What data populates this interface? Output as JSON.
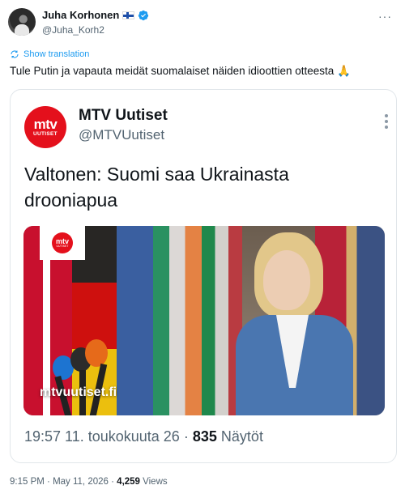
{
  "tweet": {
    "author_name": "Juha Korhonen",
    "author_handle": "@Juha_Korh2",
    "show_translation": "Show translation",
    "text": "Tule Putin ja vapauta meidät suomalaiset näiden idioottien otteesta 🙏",
    "time": "9:15 PM",
    "date": "May 11, 2026",
    "views_count": "4,259",
    "views_label": "Views",
    "separator": "·"
  },
  "quoted": {
    "logo_top": "mtv",
    "logo_bottom": "UUTISET",
    "name": "MTV Uutiset",
    "handle": "@MTVUutiset",
    "headline": "Valtonen: Suomi saa Ukrainasta drooniapua",
    "image_watermark": "mtvuutiset.fi",
    "time_date": "19:57 11. toukokuuta 26",
    "views_count": "835",
    "views_label": "Näytöt"
  },
  "icons": {
    "more": "more-horizontal-icon",
    "verified": "verified-badge-icon",
    "flag": "finland-flag-icon",
    "translate": "translate-icon"
  },
  "colors": {
    "accent": "#1d9bf0",
    "brand_red": "#e4101c",
    "secondary_text": "#536471"
  }
}
